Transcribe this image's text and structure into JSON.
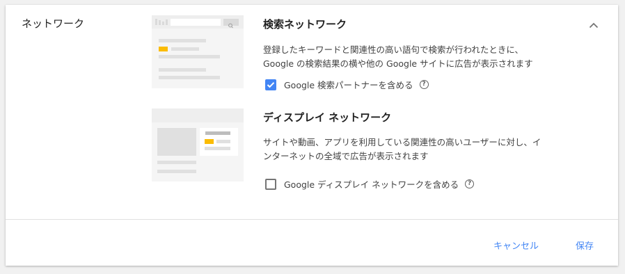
{
  "section": {
    "title": "ネットワーク"
  },
  "search_network": {
    "heading": "検索ネットワーク",
    "description_line1": "登録したキーワードと関連性の高い語句で検索が行われたときに、",
    "description_line2": "Google の検索結果の横や他の Google サイトに広告が表示されます",
    "checkbox_label": "Google 検索パートナーを含める",
    "checked": true
  },
  "display_network": {
    "heading": "ディスプレイ ネットワーク",
    "description_line1": "サイトや動画、アプリを利用している関連性の高いユーザーに対し、イ",
    "description_line2": "ンターネットの全域で広告が表示されます",
    "checkbox_label": "Google ディスプレイ ネットワークを含める",
    "checked": false
  },
  "help_glyph": "?",
  "icons": {
    "collapse": "chevron-up-icon",
    "help": "help-circle-icon",
    "check": "checkmark-icon"
  },
  "footer": {
    "cancel_label": "キャンセル",
    "save_label": "保存"
  },
  "colors": {
    "accent": "#4285f4",
    "ad_highlight": "#fbbc04"
  }
}
